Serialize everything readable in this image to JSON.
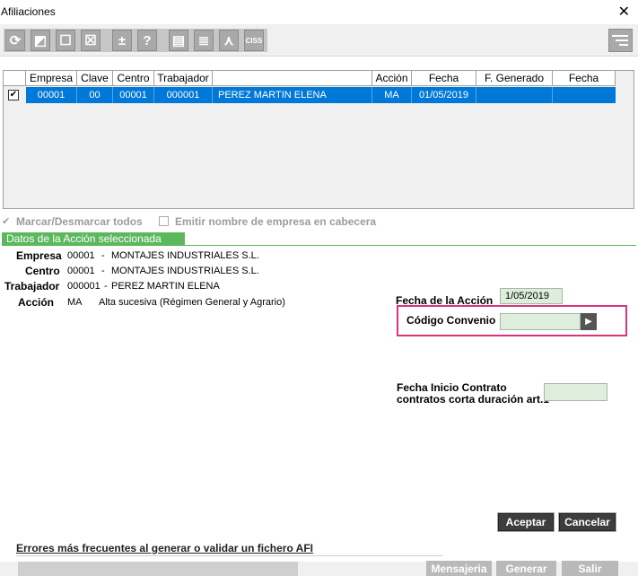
{
  "window": {
    "title": "Afiliaciones",
    "close": "✕"
  },
  "toolbar": {
    "buttons": [
      {
        "icon": "refresh-icon",
        "glyph": "⟳"
      },
      {
        "icon": "edit-icon",
        "glyph": "◩"
      },
      {
        "icon": "square-icon",
        "glyph": "☐"
      },
      {
        "icon": "delete-icon",
        "glyph": "☒"
      },
      {
        "icon": "plus-minus-icon",
        "glyph": "±"
      },
      {
        "icon": "help-icon",
        "glyph": "?"
      },
      {
        "icon": "print-icon",
        "glyph": "▤"
      },
      {
        "icon": "list-icon",
        "glyph": "≣"
      },
      {
        "icon": "pdf-icon",
        "glyph": "⋏"
      },
      {
        "icon": "ciss-icon",
        "glyph": "CISS"
      }
    ],
    "right_icon": "menu-icon"
  },
  "grid": {
    "headers": [
      "Empresa",
      "Clave",
      "Centro",
      "Trabajador",
      "",
      "Acción",
      "Fecha",
      "F. Generado",
      "Fecha"
    ],
    "row": {
      "checked": "✔",
      "cells": [
        "00001",
        "00",
        "00001",
        "000001",
        "PEREZ MARTIN ELENA",
        "MA",
        "01/05/2019",
        "",
        ""
      ]
    }
  },
  "options": {
    "select_all": "Marcar/Desmarcar todos",
    "emit_company": "Emitir nombre de empresa en cabecera"
  },
  "details": {
    "tab": "Datos de la Acción seleccionada",
    "empresa_label": "Empresa",
    "empresa_code": "00001",
    "empresa_name": "MONTAJES INDUSTRIALES S.L.",
    "centro_label": "Centro",
    "centro_code": "00001",
    "centro_name": "MONTAJES INDUSTRIALES S.L.",
    "trabajador_label": "Trabajador",
    "trabajador_code": "000001",
    "trabajador_name": "PEREZ MARTIN ELENA",
    "accion_label": "Acción",
    "accion_code": "MA",
    "accion_desc": "Alta sucesiva (Régimen General y Agrario)",
    "sep": "-"
  },
  "form": {
    "fecha_accion_label": "Fecha de la Acción",
    "fecha_accion_value": "1/05/2019",
    "codigo_convenio_label": "Código Convenio",
    "codigo_convenio_value": "",
    "fecha_inicio_label_1": "Fecha Inicio Contrato",
    "fecha_inicio_label_2": "contratos corta duración art.1",
    "fecha_inicio_value": ""
  },
  "actions": {
    "accept": "Aceptar",
    "cancel": "Cancelar"
  },
  "footer": {
    "link": "Errores más frecuentes al generar o validar un fichero AFI",
    "mensajeria": "Mensajeria",
    "generar": "Generar",
    "salir": "Salir"
  }
}
